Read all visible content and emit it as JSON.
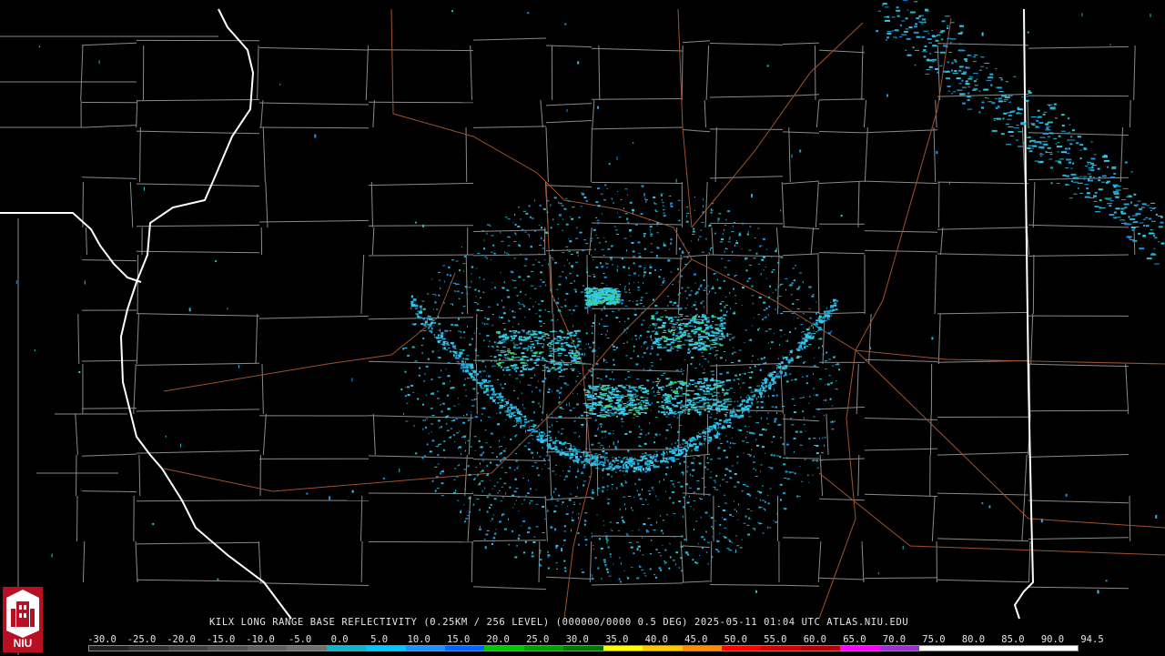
{
  "caption": "KILX LONG RANGE BASE REFLECTIVITY (0.25KM / 256 LEVEL) (000000/0000 0.5 DEG) 2025-05-11 01:04 UTC  ATLAS.NIU.EDU",
  "logo_text": "NIU",
  "scale": {
    "labels": [
      "-30.0",
      "-25.0",
      "-20.0",
      "-15.0",
      "-10.0",
      "-5.0",
      "0.0",
      "5.0",
      "10.0",
      "15.0",
      "20.0",
      "25.0",
      "30.0",
      "35.0",
      "40.0",
      "45.0",
      "50.0",
      "55.0",
      "60.0",
      "65.0",
      "70.0",
      "75.0",
      "80.0",
      "85.0",
      "90.0",
      "94.5"
    ],
    "colors": [
      "#202020",
      "#303030",
      "#404040",
      "#505050",
      "#606060",
      "#707070",
      "#0fb4c8",
      "#00c8ff",
      "#1e90ff",
      "#0064ff",
      "#00c800",
      "#00a000",
      "#007800",
      "#ffff00",
      "#ffc800",
      "#ff8c00",
      "#ff0000",
      "#d40000",
      "#b40000",
      "#ff00ff",
      "#9932cc",
      "#ffffff",
      "#ffffff",
      "#ffffff",
      "#ffffff"
    ]
  },
  "colors": {
    "background": "#000000",
    "county_lines": "#8a8a8a",
    "state_lines": "#ffffff",
    "highways": "#a0522d",
    "echo_light": "#1fa8d8",
    "echo_mid": "#36c8e8",
    "echo_strong": "#3ad070"
  }
}
